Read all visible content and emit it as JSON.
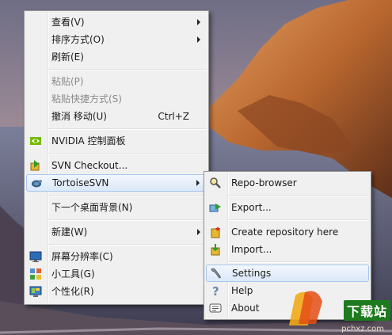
{
  "context_menu": {
    "items": [
      {
        "label": "查看(V)",
        "submenu": true
      },
      {
        "label": "排序方式(O)",
        "submenu": true
      },
      {
        "label": "刷新(E)"
      },
      {
        "label": "粘贴(P)",
        "disabled": true
      },
      {
        "label": "粘贴快捷方式(S)",
        "disabled": true
      },
      {
        "label": "撤消 移动(U)",
        "shortcut": "Ctrl+Z"
      },
      {
        "label": "NVIDIA 控制面板",
        "icon": "nvidia-icon"
      },
      {
        "label": "SVN Checkout...",
        "icon": "svn-checkout-icon"
      },
      {
        "label": "TortoiseSVN",
        "icon": "tortoisesvn-icon",
        "submenu": true,
        "highlighted": true
      },
      {
        "label": "下一个桌面背景(N)"
      },
      {
        "label": "新建(W)",
        "submenu": true
      },
      {
        "label": "屏幕分辨率(C)",
        "icon": "screen-resolution-icon"
      },
      {
        "label": "小工具(G)",
        "icon": "gadgets-icon"
      },
      {
        "label": "个性化(R)",
        "icon": "personalize-icon"
      }
    ]
  },
  "submenu": {
    "items": [
      {
        "label": "Repo-browser",
        "icon": "repo-browser-icon"
      },
      {
        "label": "Export...",
        "icon": "export-icon"
      },
      {
        "label": "Create repository here",
        "icon": "create-repository-icon"
      },
      {
        "label": "Import...",
        "icon": "import-icon"
      },
      {
        "label": "Settings",
        "icon": "settings-icon",
        "highlighted": true
      },
      {
        "label": "Help",
        "icon": "help-icon"
      },
      {
        "label": "About",
        "icon": "about-icon"
      }
    ]
  },
  "watermark": {
    "brand": "下载站",
    "url": "pchxz.com"
  },
  "colors": {
    "menu_bg": "#f0f0f0",
    "highlight": "#dbe8f8",
    "nvidia": "#76b900",
    "sky": "#8c8fa6",
    "rock": "#c77a3e"
  }
}
